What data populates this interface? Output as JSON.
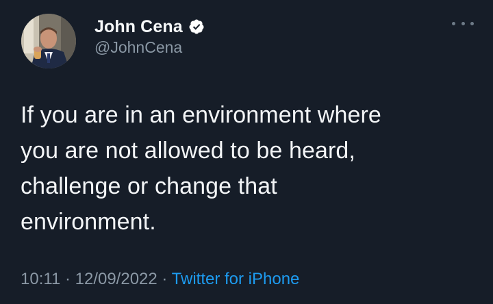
{
  "author": {
    "display_name": "John Cena",
    "handle": "@JohnCena",
    "verified": true
  },
  "tweet": {
    "text_lines": [
      "If you are in an environment where",
      "you are not allowed to be heard,",
      "challenge or change that",
      "environment."
    ],
    "time": "10:11",
    "separator": "·",
    "date": "12/09/2022",
    "source": "Twitter for iPhone"
  },
  "icons": {
    "verified": "verified-badge-icon",
    "more": "more-options-icon"
  },
  "colors": {
    "background": "#161d28",
    "link": "#1d9bf0",
    "secondary_text": "#8b98a5"
  }
}
